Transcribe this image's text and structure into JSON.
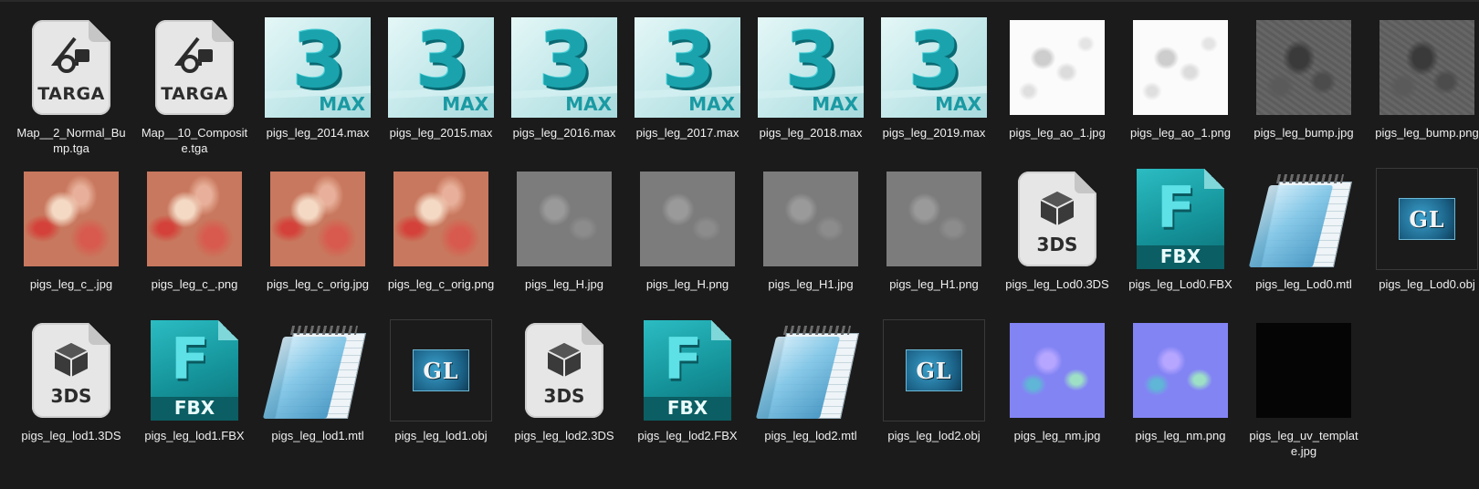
{
  "files": [
    {
      "name": "Map__2_Normal_Bump.tga",
      "icon": "targa-file-icon",
      "badge": "TARGA"
    },
    {
      "name": "Map__10_Composite.tga",
      "icon": "targa-file-icon",
      "badge": "TARGA"
    },
    {
      "name": "pigs_leg_2014.max",
      "icon": "3dsmax-file-icon",
      "badge": "MAX"
    },
    {
      "name": "pigs_leg_2015.max",
      "icon": "3dsmax-file-icon",
      "badge": "MAX"
    },
    {
      "name": "pigs_leg_2016.max",
      "icon": "3dsmax-file-icon",
      "badge": "MAX"
    },
    {
      "name": "pigs_leg_2017.max",
      "icon": "3dsmax-file-icon",
      "badge": "MAX"
    },
    {
      "name": "pigs_leg_2018.max",
      "icon": "3dsmax-file-icon",
      "badge": "MAX"
    },
    {
      "name": "pigs_leg_2019.max",
      "icon": "3dsmax-file-icon",
      "badge": "MAX"
    },
    {
      "name": "pigs_leg_ao_1.jpg",
      "icon": "ao-texture-thumbnail"
    },
    {
      "name": "pigs_leg_ao_1.png",
      "icon": "ao-texture-thumbnail"
    },
    {
      "name": "pigs_leg_bump.jpg",
      "icon": "bump-texture-thumbnail"
    },
    {
      "name": "pigs_leg_bump.png",
      "icon": "bump-texture-thumbnail"
    },
    {
      "name": "pigs_leg_c_.jpg",
      "icon": "color-texture-thumbnail"
    },
    {
      "name": "pigs_leg_c_.png",
      "icon": "color-texture-thumbnail"
    },
    {
      "name": "pigs_leg_c_orig.jpg",
      "icon": "color-texture-thumbnail"
    },
    {
      "name": "pigs_leg_c_orig.png",
      "icon": "color-texture-thumbnail"
    },
    {
      "name": "pigs_leg_H.jpg",
      "icon": "height-texture-thumbnail"
    },
    {
      "name": "pigs_leg_H.png",
      "icon": "height-texture-thumbnail"
    },
    {
      "name": "pigs_leg_H1.jpg",
      "icon": "height-texture-thumbnail"
    },
    {
      "name": "pigs_leg_H1.png",
      "icon": "height-texture-thumbnail"
    },
    {
      "name": "pigs_leg_Lod0.3DS",
      "icon": "3ds-file-icon",
      "badge": "3DS"
    },
    {
      "name": "pigs_leg_Lod0.FBX",
      "icon": "fbx-file-icon",
      "badge": "FBX"
    },
    {
      "name": "pigs_leg_Lod0.mtl",
      "icon": "notepad-file-icon"
    },
    {
      "name": "pigs_leg_Lod0.obj",
      "icon": "opengl-obj-file-icon",
      "badge": "GL"
    },
    {
      "name": "pigs_leg_lod1.3DS",
      "icon": "3ds-file-icon",
      "badge": "3DS"
    },
    {
      "name": "pigs_leg_lod1.FBX",
      "icon": "fbx-file-icon",
      "badge": "FBX"
    },
    {
      "name": "pigs_leg_lod1.mtl",
      "icon": "notepad-file-icon"
    },
    {
      "name": "pigs_leg_lod1.obj",
      "icon": "opengl-obj-file-icon",
      "badge": "GL"
    },
    {
      "name": "pigs_leg_lod2.3DS",
      "icon": "3ds-file-icon",
      "badge": "3DS"
    },
    {
      "name": "pigs_leg_lod2.FBX",
      "icon": "fbx-file-icon",
      "badge": "FBX"
    },
    {
      "name": "pigs_leg_lod2.mtl",
      "icon": "notepad-file-icon"
    },
    {
      "name": "pigs_leg_lod2.obj",
      "icon": "opengl-obj-file-icon",
      "badge": "GL"
    },
    {
      "name": "pigs_leg_nm.jpg",
      "icon": "normal-map-texture-thumbnail"
    },
    {
      "name": "pigs_leg_nm.png",
      "icon": "normal-map-texture-thumbnail"
    },
    {
      "name": "pigs_leg_uv_template.jpg",
      "icon": "uv-template-texture-thumbnail"
    }
  ]
}
